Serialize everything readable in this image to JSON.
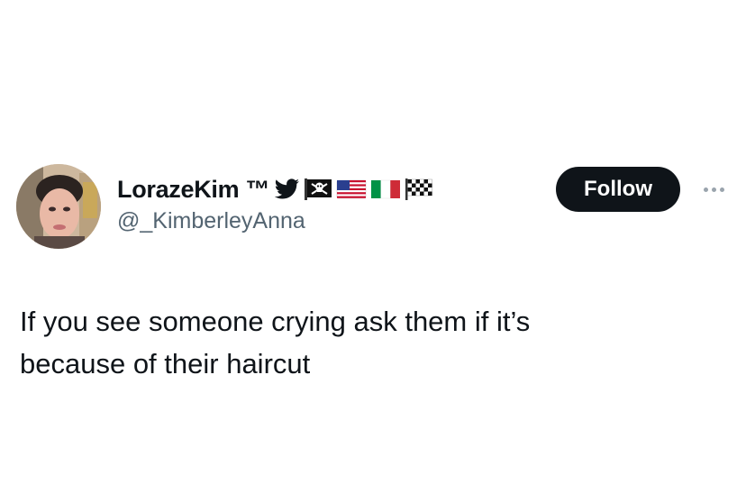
{
  "tweet": {
    "author": {
      "display_name": "LorazeKim ™",
      "handle": "@_KimberleyAnna",
      "badges": [
        "bird-icon",
        "pirate-flag-icon",
        "us-flag-icon",
        "italy-flag-icon",
        "checkered-flag-icon"
      ]
    },
    "follow_label": "Follow",
    "more_icon": "more-horizontal-icon",
    "text": "If you see someone crying ask them if it’s\nbecause of their haircut"
  },
  "colors": {
    "text_primary": "#0f1419",
    "text_secondary": "#536471",
    "follow_bg": "#0f1419",
    "follow_text": "#ffffff"
  }
}
